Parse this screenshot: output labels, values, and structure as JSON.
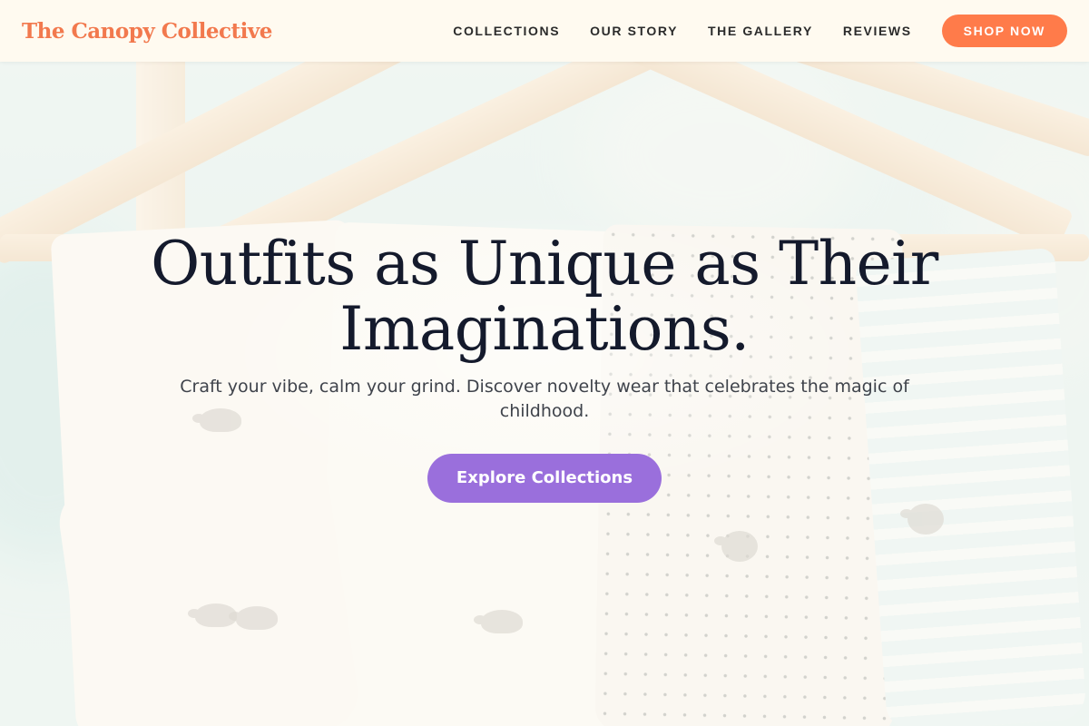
{
  "header": {
    "brand": "The Canopy Collective",
    "nav": [
      {
        "label": "COLLECTIONS"
      },
      {
        "label": "OUR STORY"
      },
      {
        "label": "THE GALLERY"
      },
      {
        "label": "REVIEWS"
      }
    ],
    "shop_label": "SHOP NOW"
  },
  "hero": {
    "title": "Outfits as Unique as Their Imaginations.",
    "subtitle": "Craft your vibe, calm your grind. Discover novelty wear that celebrates the magic of childhood.",
    "cta_label": "Explore Collections"
  },
  "colors": {
    "brand": "#f2794e",
    "shop_button": "#ff7b4a",
    "cta_button": "#9a6fdc",
    "title_text": "#141a2c"
  }
}
